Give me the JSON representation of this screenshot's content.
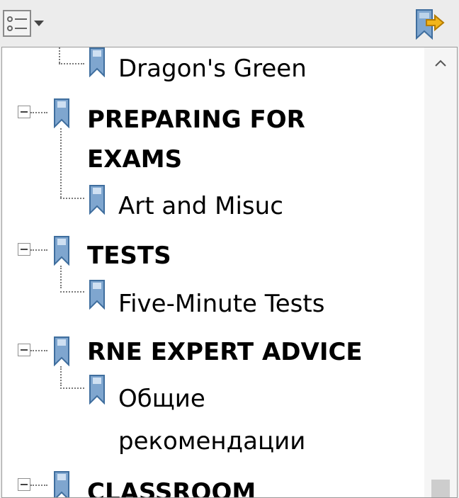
{
  "toolbar": {
    "options_icon": "list-options-icon",
    "bookmark_icon": "bookmark-goto-icon"
  },
  "tree": {
    "items": [
      {
        "label": "Dragon's Green",
        "level": "child",
        "icon": "bookmark-icon"
      },
      {
        "label_line1": "PREPARING FOR",
        "label_line2": "EXAMS",
        "level": "parent",
        "icon": "bookmark-icon",
        "expanded": true
      },
      {
        "label": "Art and Misuc",
        "level": "child",
        "icon": "bookmark-icon"
      },
      {
        "label": "TESTS",
        "level": "parent",
        "icon": "bookmark-icon",
        "expanded": true
      },
      {
        "label": "Five-Minute Tests",
        "level": "child",
        "icon": "bookmark-icon"
      },
      {
        "label": "RNE EXPERT ADVICE",
        "level": "parent",
        "icon": "bookmark-icon",
        "expanded": true
      },
      {
        "label_line1": "Общие",
        "label_line2": "рекомендации",
        "level": "child",
        "icon": "bookmark-icon"
      },
      {
        "label": "CLASSROOM",
        "level": "parent",
        "icon": "bookmark-icon",
        "expanded": true
      }
    ]
  },
  "colors": {
    "bookmark_fill": "#7fa6cf",
    "bookmark_stroke": "#3f6e9e",
    "background": "#ececec",
    "panel": "#ffffff"
  }
}
